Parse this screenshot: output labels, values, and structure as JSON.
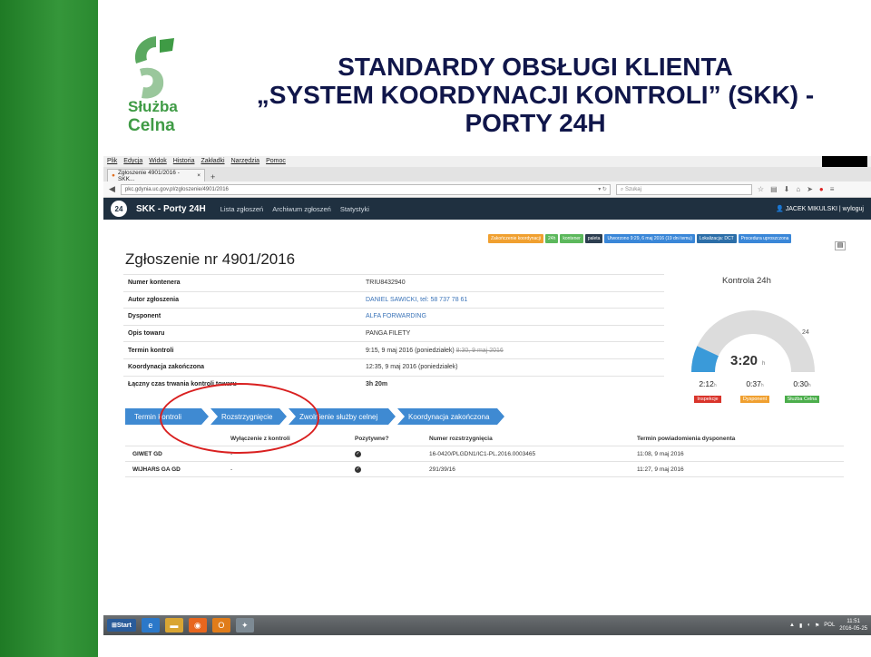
{
  "slide": {
    "title_line1": "STANDARDY OBSŁUGI KLIENTA",
    "title_line2": "„SYSTEM KOORDYNACJI KONTROLI” (SKK) -",
    "title_line3": "PORTY 24H",
    "logo_line1": "Służba",
    "logo_line2": "Celna",
    "colors": {
      "green": "#2f8f35",
      "title": "#10164a"
    }
  },
  "browser": {
    "menu": [
      "Plik",
      "Edycja",
      "Widok",
      "Historia",
      "Zakładki",
      "Narzędzia",
      "Pomoc"
    ],
    "tab_title": "Zgłoszenie 4901/2016 - SKK...",
    "url": "pkc.gdynia.uc.gov.pl/zgloszenie/4901/2016",
    "search_placeholder": "Szukaj"
  },
  "app": {
    "logo": "24",
    "name": "SKK - Porty 24H",
    "nav": [
      "Lista zgłoszeń",
      "Archiwum zgłoszeń",
      "Statystyki"
    ],
    "user": "JACEK MIKULSKI | wyloguj"
  },
  "badges": [
    {
      "text": "Zakończenie koordynacji",
      "color": "#f0a030"
    },
    {
      "text": "24h",
      "color": "#5cb85c"
    },
    {
      "text": "kontener",
      "color": "#5cb85c"
    },
    {
      "text": "paleta",
      "color": "#2c3e50"
    },
    {
      "text": "Utworzono 9:29, 6 maj 2016 (19 dni temu)",
      "color": "#3a87d8"
    },
    {
      "text": "Lokalizacja: DCT",
      "color": "#2c6ea8"
    },
    {
      "text": "Procedura uproszczona",
      "color": "#3a87d8"
    }
  ],
  "page": {
    "heading": "Zgłoszenie nr 4901/2016",
    "details": [
      {
        "label": "Numer kontenera",
        "value": "TRIU8432940"
      },
      {
        "label": "Autor zgłoszenia",
        "value": "DANIEL SAWICKI, tel: 58 737 78 61"
      },
      {
        "label": "Dysponent",
        "value": "ALFA FORWARDING"
      },
      {
        "label": "Opis towaru",
        "value": "PANGA FILETY"
      },
      {
        "label": "Termin kontroli",
        "value": "9:15, 9 maj 2016 (poniedziałek)",
        "struck": "8:30, 9 maj 2016"
      },
      {
        "label": "Koordynacja zakończona",
        "value": "12:35, 9 maj 2016 (poniedziałek)"
      },
      {
        "label": "Łączny czas trwania kontroli towaru",
        "value": "3h 20m"
      }
    ]
  },
  "gauge": {
    "title": "Kontrola 24h",
    "time": "3:20",
    "unit": "h",
    "max_label": "24",
    "fill_fraction": 0.139,
    "stats": [
      {
        "value": "2:12",
        "unit": "h",
        "label": "Inspekcje",
        "color": "#d9342b"
      },
      {
        "value": "0:37",
        "unit": "h",
        "label": "Dysponent",
        "color": "#f0a030"
      },
      {
        "value": "0:30",
        "unit": "h",
        "label": "Służba Celna",
        "color": "#4cae4c"
      }
    ]
  },
  "steps": [
    "Termin kontroli",
    "Rozstrzygnięcie",
    "Zwolnienie służby celnej",
    "Koordynacja zakończona"
  ],
  "table": {
    "headers": [
      "",
      "Wyłączenie z kontroli",
      "Pozytywne?",
      "Numer rozstrzygnięcia",
      "Termin powiadomienia dysponenta"
    ],
    "rows": [
      {
        "name": "GIWET GD",
        "excl": "-",
        "decision": "16-0420/PLGDN1/IC1-PL.2016.0003465",
        "notified": "11:08, 9 maj 2016"
      },
      {
        "name": "WIJHARS GA GD",
        "excl": "-",
        "decision": "291/39/16",
        "notified": "11:27, 9 maj 2016"
      }
    ]
  },
  "taskbar": {
    "start": "Start",
    "lang": "POL",
    "time": "11:51",
    "date": "2016-05-25"
  }
}
